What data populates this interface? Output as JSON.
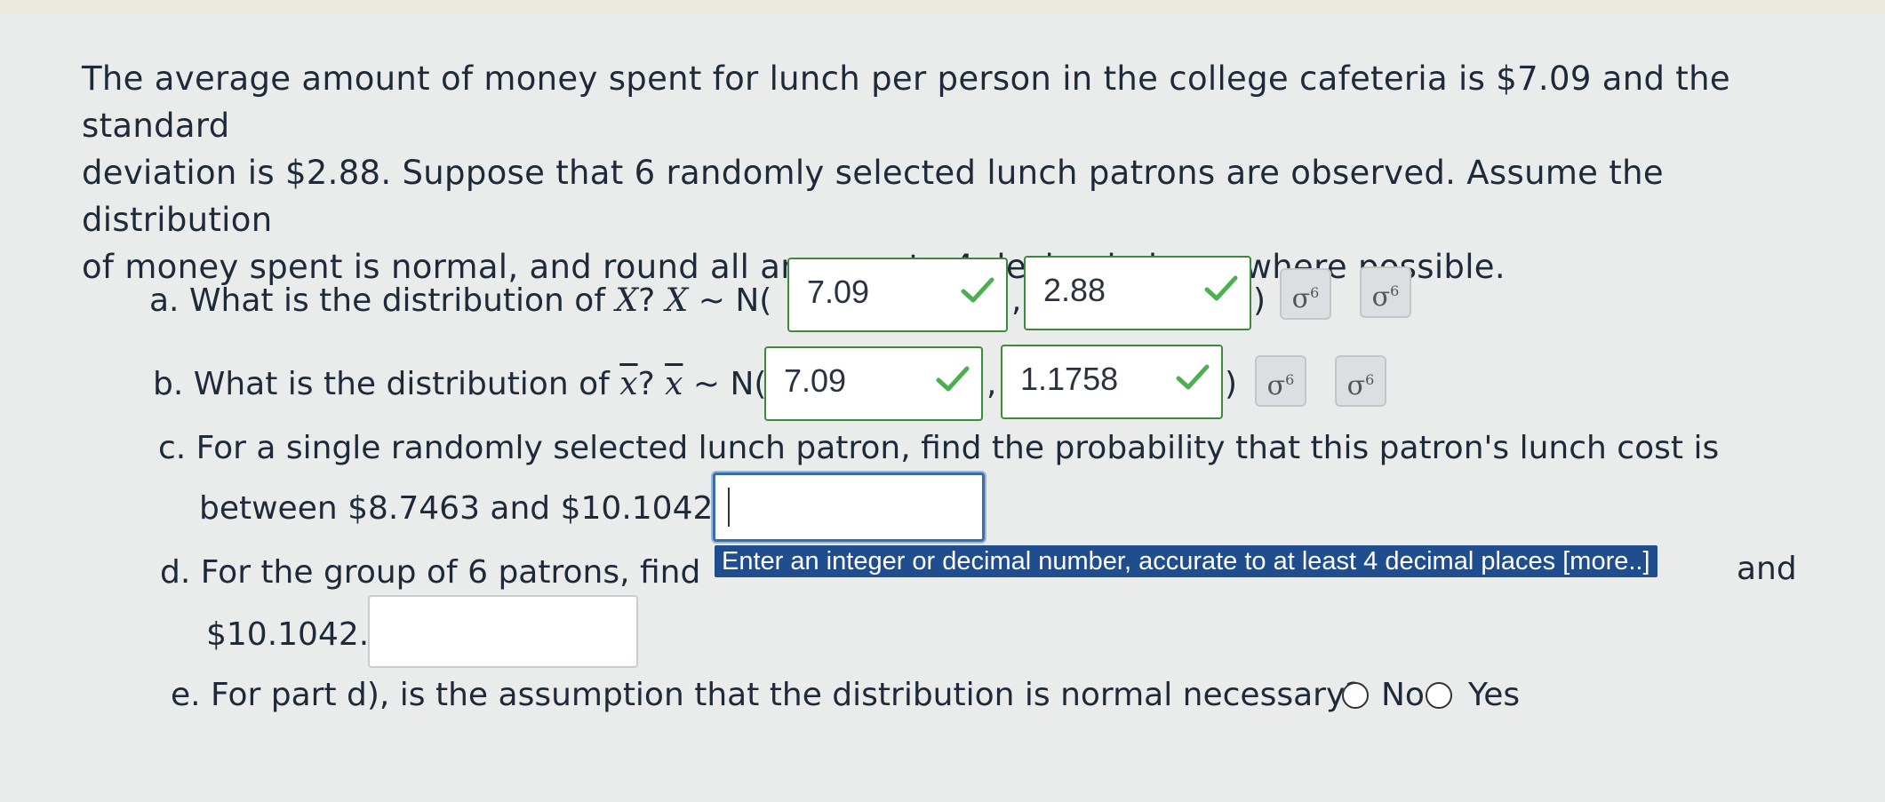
{
  "intro_line1": "The average amount of money spent for lunch per person in the college cafeteria is $7.09 and the standard",
  "intro_line2": "deviation is $2.88. Suppose that 6 randomly selected lunch patrons are observed. Assume the distribution",
  "intro_line3": "of money spent is normal, and round all answers to 4 decimal places where possible.",
  "part_a": {
    "prefix": "a. What is the distribution of",
    "var": "X",
    "mid": "?",
    "dist": "~ N(",
    "mean_value": "7.09",
    "sd_value": "2.88",
    "close": ")"
  },
  "part_b": {
    "prefix": "b. What is the distribution of",
    "var": "x",
    "mid": "?",
    "dist": "~ N(",
    "mean_value": "7.09",
    "sd_value": "1.1758",
    "close": ")"
  },
  "part_c": {
    "line1": "c. For a single randomly selected lunch patron, find the probability that this patron's lunch cost is",
    "line2": "between $8.7463 and $10.1042.",
    "answer_value": ""
  },
  "part_d": {
    "line1_start": "d. For the group of 6 patrons, find",
    "line1_end": "and",
    "line2": "$10.1042.",
    "answer_value": ""
  },
  "tooltip": "Enter an integer or decimal number, accurate to at least 4 decimal places [more..]",
  "part_e": {
    "question": "e. For part d), is the assumption that the distribution is normal necessary?",
    "options": [
      "No",
      "Yes"
    ]
  },
  "symbols": {
    "sigma": "σ",
    "sigma_sup": "6",
    "sigma_icon": "sigma-icon",
    "check_icon": "checkmark-icon"
  },
  "colors": {
    "correct_border": "#3d8a3a",
    "check": "#4caf50",
    "tooltip_bg": "#1f4d8e"
  }
}
